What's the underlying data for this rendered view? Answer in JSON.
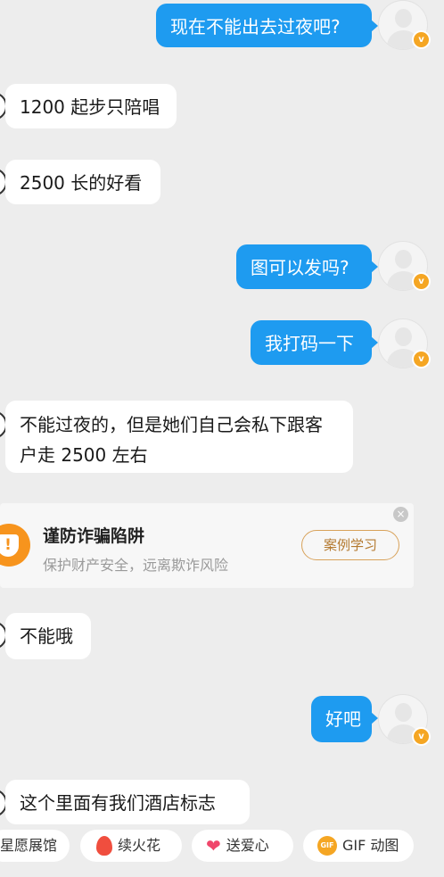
{
  "messages": [
    {
      "side": "out",
      "text": "现在不能出去过夜吧?"
    },
    {
      "side": "in",
      "text": "1200 起步只陪唱"
    },
    {
      "side": "in",
      "text": "2500 长的好看"
    },
    {
      "side": "out",
      "text": "图可以发吗?"
    },
    {
      "side": "out",
      "text": "我打码一下"
    },
    {
      "side": "in",
      "text": "不能过夜的，但是她们自己会私下跟客户走 2500 左右"
    },
    {
      "side": "in",
      "text": "不能哦"
    },
    {
      "side": "out",
      "text": "好吧"
    },
    {
      "side": "in",
      "text": "这个里面有我们酒店标志"
    }
  ],
  "safety_card": {
    "title": "谨防诈骗陷阱",
    "subtitle": "保护财产安全，远离欺诈风险",
    "button_label": "案例学习",
    "close_symbol": "×"
  },
  "badges": {
    "verified_symbol": "v"
  },
  "shortcuts": [
    {
      "label": "星愿展馆",
      "icon": null
    },
    {
      "label": "续火花",
      "icon": "fire-icon"
    },
    {
      "label": "送爱心",
      "icon": "heart-icon"
    },
    {
      "label": "GIF 动图",
      "icon": "gif-icon",
      "icon_text": "GIF"
    }
  ],
  "colors": {
    "outgoing_bubble": "#1e9bf0",
    "incoming_bubble": "#ffffff",
    "background": "#ededed",
    "warning_orange": "#f7941d",
    "verified_badge": "#f5a623"
  }
}
